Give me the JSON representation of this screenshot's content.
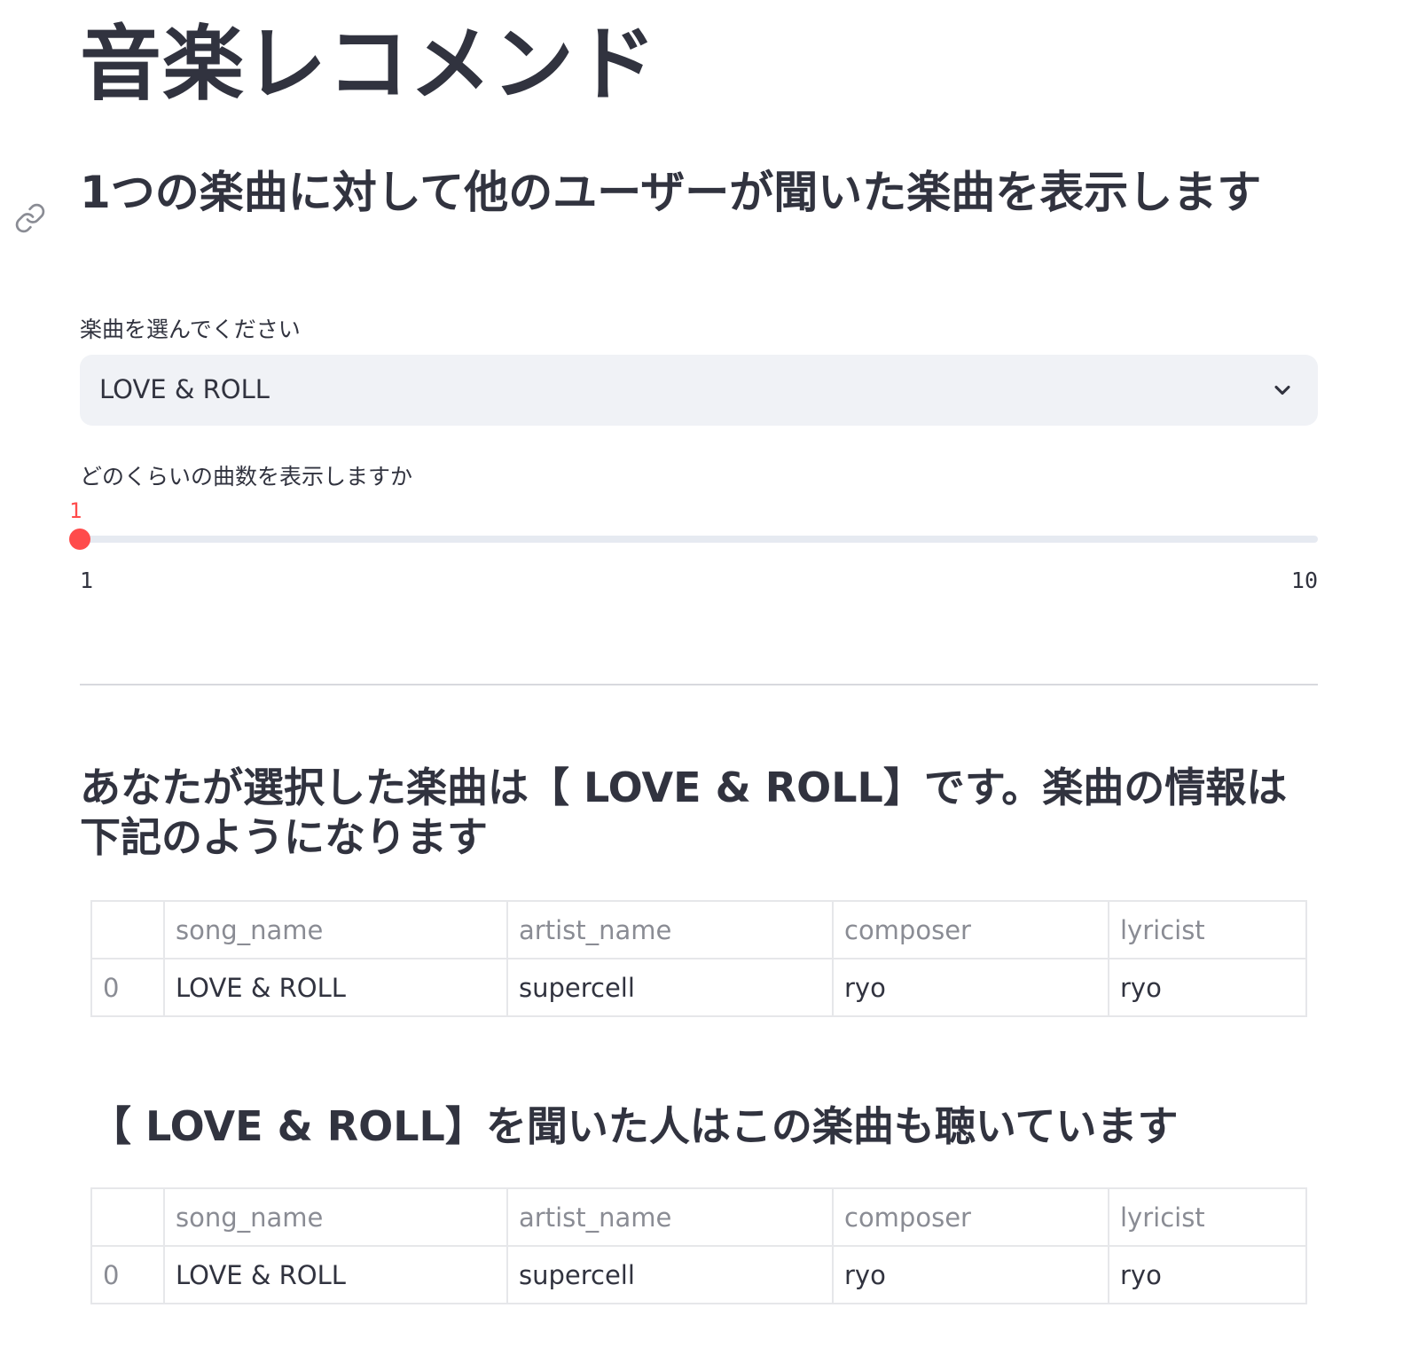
{
  "page": {
    "title": "音楽レコメンド"
  },
  "subheader": "1つの楽曲に対して他のユーザーが聞いた楽曲を表示します",
  "song_select": {
    "label": "楽曲を選んでください",
    "selected_value": "LOVE & ROLL",
    "icon": "chevron-down-icon"
  },
  "count_slider": {
    "label": "どのくらいの曲数を表示しますか",
    "current_value": "1",
    "min_label": "1",
    "max_label": "10",
    "value": 1,
    "min": 1,
    "max": 10,
    "accent_color": "#ff4b4b"
  },
  "selected_section": {
    "heading": "あなたが選択した楽曲は【 LOVE & ROLL】です。楽曲の情報は下記のようになります",
    "table": {
      "headers": [
        "",
        "song_name",
        "artist_name",
        "composer",
        "lyricist"
      ],
      "rows": [
        [
          "0",
          "LOVE & ROLL",
          "supercell",
          "ryo",
          "ryo"
        ]
      ]
    }
  },
  "recommend_section": {
    "heading": "【 LOVE & ROLL】を聞いた人はこの楽曲も聴いています",
    "table": {
      "headers": [
        "",
        "song_name",
        "artist_name",
        "composer",
        "lyricist"
      ],
      "rows": [
        [
          "0",
          "LOVE & ROLL",
          "supercell",
          "ryo",
          "ryo"
        ]
      ]
    }
  },
  "icons": {
    "anchor": "link-icon",
    "select": "chevron-down-icon"
  },
  "colors": {
    "text": "#31333f",
    "accent": "#ff4b4b",
    "select_background": "#f0f2f6",
    "table_header_text": "#8a8c94"
  }
}
